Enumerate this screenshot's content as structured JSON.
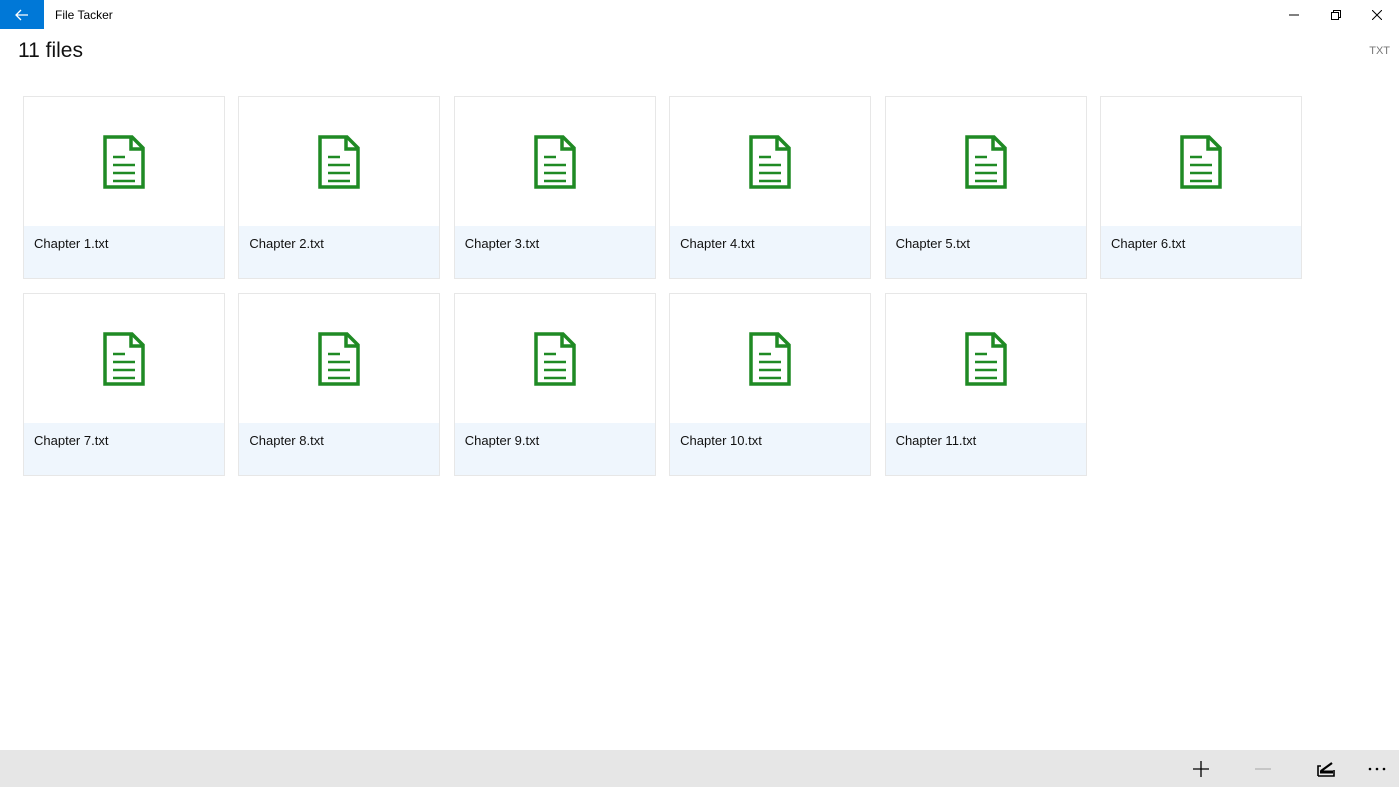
{
  "window": {
    "title": "File Tacker"
  },
  "header": {
    "count_label": "11 files",
    "filter_label": "TXT"
  },
  "files": [
    {
      "name": "Chapter 1.txt",
      "icon": "text-file-icon"
    },
    {
      "name": "Chapter 2.txt",
      "icon": "text-file-icon"
    },
    {
      "name": "Chapter 3.txt",
      "icon": "text-file-icon"
    },
    {
      "name": "Chapter 4.txt",
      "icon": "text-file-icon"
    },
    {
      "name": "Chapter 5.txt",
      "icon": "text-file-icon"
    },
    {
      "name": "Chapter 6.txt",
      "icon": "text-file-icon"
    },
    {
      "name": "Chapter 7.txt",
      "icon": "text-file-icon"
    },
    {
      "name": "Chapter 8.txt",
      "icon": "text-file-icon"
    },
    {
      "name": "Chapter 9.txt",
      "icon": "text-file-icon"
    },
    {
      "name": "Chapter 10.txt",
      "icon": "text-file-icon"
    },
    {
      "name": "Chapter 11.txt",
      "icon": "text-file-icon"
    }
  ],
  "commandbar": {
    "buttons": [
      {
        "icon": "add-icon"
      },
      {
        "icon": "remove-icon"
      },
      {
        "icon": "open-folder-icon"
      },
      {
        "icon": "more-icon"
      }
    ]
  },
  "colors": {
    "accent": "#0078d7",
    "file_icon": "#1f8a24",
    "caption_bg": "#eff6fd",
    "commandbar_bg": "#e6e6e6"
  }
}
